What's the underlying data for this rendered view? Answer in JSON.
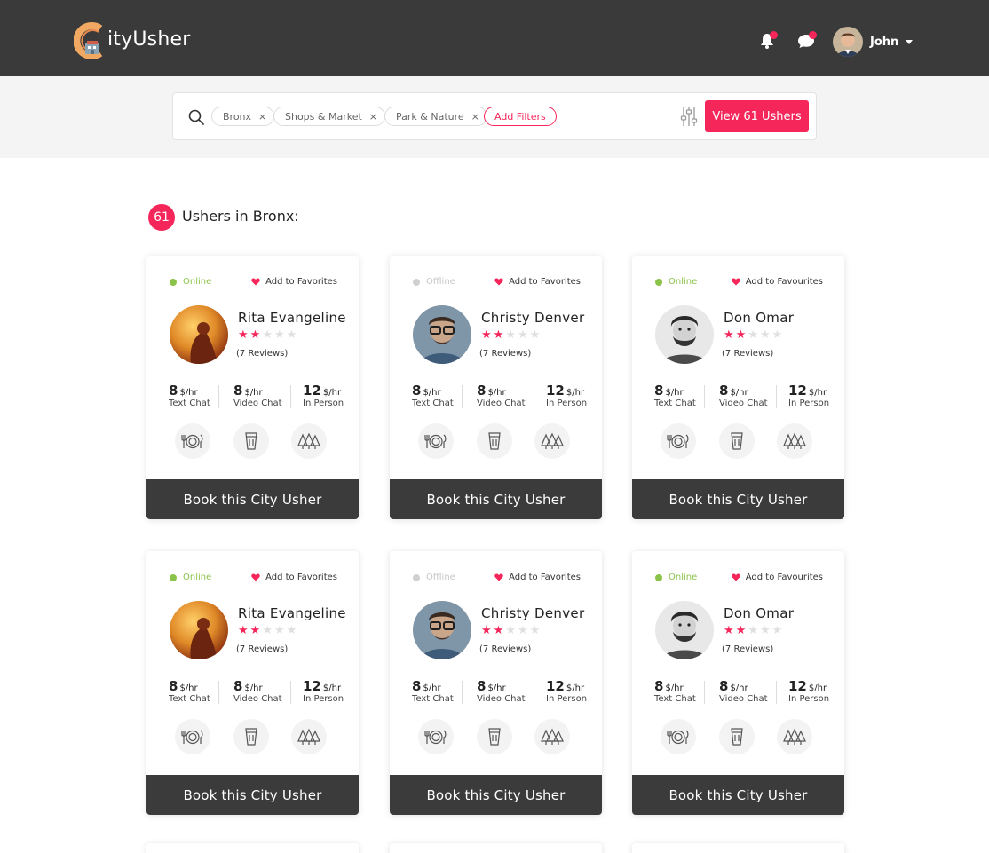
{
  "header": {
    "logo_text": "ityUsher",
    "user_name": "John"
  },
  "search": {
    "chips": [
      {
        "label": "Bronx"
      },
      {
        "label": "Shops & Market"
      },
      {
        "label": "Park & Nature"
      }
    ],
    "chip_remove": "×",
    "add_filters": "Add Filters",
    "view_button": "View 61 Ushers"
  },
  "results": {
    "count": "61",
    "title": "Ushers in Bronx:"
  },
  "cards": [
    {
      "status": "Online",
      "favorite": "Add to Favorites",
      "name": "Rita Evangeline",
      "rating": 2,
      "max_rating": 5,
      "reviews": "(7 Reviews)",
      "rates": [
        {
          "amount": "8",
          "unit": "$/hr",
          "label": "Text Chat"
        },
        {
          "amount": "8",
          "unit": "$/hr",
          "label": "Video Chat"
        },
        {
          "amount": "12",
          "unit": "$/hr",
          "label": "In Person"
        }
      ],
      "button": "Book this City Usher"
    },
    {
      "status": "Offline",
      "favorite": "Add to Favorites",
      "name": "Christy Denver",
      "rating": 2,
      "max_rating": 5,
      "reviews": "(7 Reviews)",
      "rates": [
        {
          "amount": "8",
          "unit": "$/hr",
          "label": "Text Chat"
        },
        {
          "amount": "8",
          "unit": "$/hr",
          "label": "Video Chat"
        },
        {
          "amount": "12",
          "unit": "$/hr",
          "label": "In Person"
        }
      ],
      "button": "Book this City Usher"
    },
    {
      "status": "Online",
      "favorite": "Add to Favourites",
      "name": "Don Omar",
      "rating": 2,
      "max_rating": 5,
      "reviews": "(7 Reviews)",
      "rates": [
        {
          "amount": "8",
          "unit": "$/hr",
          "label": "Text Chat"
        },
        {
          "amount": "8",
          "unit": "$/hr",
          "label": "Video Chat"
        },
        {
          "amount": "12",
          "unit": "$/hr",
          "label": "In Person"
        }
      ],
      "button": "Book this City Usher"
    },
    {
      "status": "Online",
      "favorite": "Add to Favorites",
      "name": "Rita Evangeline",
      "rating": 2,
      "max_rating": 5,
      "reviews": "(7 Reviews)",
      "rates": [
        {
          "amount": "8",
          "unit": "$/hr",
          "label": "Text Chat"
        },
        {
          "amount": "8",
          "unit": "$/hr",
          "label": "Video Chat"
        },
        {
          "amount": "12",
          "unit": "$/hr",
          "label": "In Person"
        }
      ],
      "button": "Book this City Usher"
    },
    {
      "status": "Offline",
      "favorite": "Add to Favorites",
      "name": "Christy Denver",
      "rating": 2,
      "max_rating": 5,
      "reviews": "(7 Reviews)",
      "rates": [
        {
          "amount": "8",
          "unit": "$/hr",
          "label": "Text Chat"
        },
        {
          "amount": "8",
          "unit": "$/hr",
          "label": "Video Chat"
        },
        {
          "amount": "12",
          "unit": "$/hr",
          "label": "In Person"
        }
      ],
      "button": "Book this City Usher"
    },
    {
      "status": "Online",
      "favorite": "Add to Favourites",
      "name": "Don Omar",
      "rating": 2,
      "max_rating": 5,
      "reviews": "(7 Reviews)",
      "rates": [
        {
          "amount": "8",
          "unit": "$/hr",
          "label": "Text Chat"
        },
        {
          "amount": "8",
          "unit": "$/hr",
          "label": "Video Chat"
        },
        {
          "amount": "12",
          "unit": "$/hr",
          "label": "In Person"
        }
      ],
      "button": "Book this City Usher"
    }
  ],
  "colors": {
    "accent": "#f5265a",
    "online": "#8bc34a",
    "offline": "#d0d0d0",
    "header_bg": "#3a3a3a",
    "button_bg": "#3b3b3b",
    "star_empty": "#e0e0e0"
  },
  "icons": {
    "categories": [
      "food-icon",
      "drink-icon",
      "nature-icon"
    ]
  }
}
